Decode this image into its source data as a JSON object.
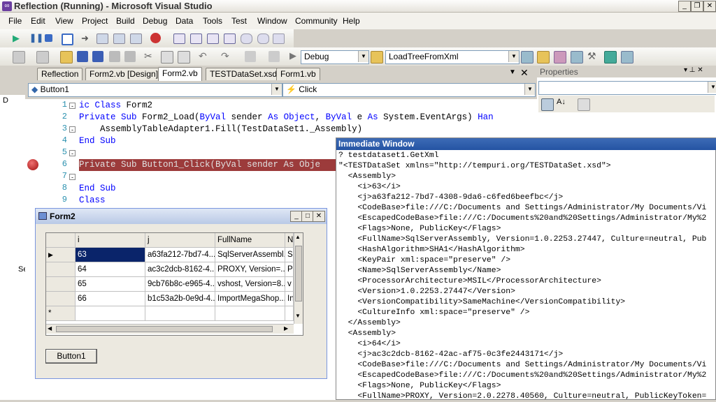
{
  "window": {
    "title": "Reflection (Running) - Microsoft Visual Studio"
  },
  "menu": [
    "File",
    "Edit",
    "View",
    "Project",
    "Build",
    "Debug",
    "Data",
    "Tools",
    "Test",
    "Window",
    "Community",
    "Help"
  ],
  "toolbar": {
    "config": "Debug",
    "find_combo": "LoadTreeFromXml"
  },
  "tabs": [
    "Reflection",
    "Form2.vb [Design]",
    "Form2.vb",
    "TESTDataSet.xsd",
    "Form1.vb"
  ],
  "active_tab": "Form2.vb",
  "editor": {
    "object_combo": "Button1",
    "event_combo": "Click",
    "lines": [
      {
        "num": "1",
        "parts": [
          {
            "t": "ic Class ",
            "k": true
          },
          {
            "t": "Form2",
            "k": false
          }
        ]
      },
      {
        "num": "2",
        "parts": [
          {
            "t": "Private Sub ",
            "k": true
          },
          {
            "t": "Form2_Load(",
            "k": false
          },
          {
            "t": "ByVal ",
            "k": true
          },
          {
            "t": "sender ",
            "k": false
          },
          {
            "t": "As Object",
            "k": true
          },
          {
            "t": ", ",
            "k": false
          },
          {
            "t": "ByVal ",
            "k": true
          },
          {
            "t": "e ",
            "k": false
          },
          {
            "t": "As ",
            "k": true
          },
          {
            "t": "System.EventArgs) ",
            "k": false
          },
          {
            "t": "Han",
            "k": true
          }
        ]
      },
      {
        "num": "3",
        "parts": [
          {
            "t": "    AssemblyTableAdapter1.Fill(TestDataSet1._Assembly)",
            "k": false
          }
        ]
      },
      {
        "num": "4",
        "parts": [
          {
            "t": "End Sub",
            "k": true
          }
        ]
      },
      {
        "num": "5",
        "parts": []
      },
      {
        "num": "6",
        "parts": [
          {
            "t": "Private Sub Button1_Click(ByVal sender As Obje",
            "k": false
          }
        ]
      },
      {
        "num": "7",
        "parts": []
      },
      {
        "num": "8",
        "parts": [
          {
            "t": "End Sub",
            "k": true
          }
        ]
      },
      {
        "num": "9",
        "parts": [
          {
            "t": "Class",
            "k": true
          }
        ]
      }
    ]
  },
  "properties": {
    "title": "Properties"
  },
  "immediate": {
    "title": "Immediate Window",
    "lines": [
      "? testdataset1.GetXml",
      "\"<TESTDataSet xmlns=\"http://tempuri.org/TESTDataSet.xsd\">",
      "  <Assembly>",
      "    <i>63</i>",
      "    <j>a63fa212-7bd7-4308-9da6-c6fed6beefbc</j>",
      "    <CodeBase>file:///C:/Documents and Settings/Administrator/My Documents/Vi",
      "    <EscapedCodeBase>file:///C:/Documents%20and%20Settings/Administrator/My%2",
      "    <Flags>None, PublicKey</Flags>",
      "    <FullName>SqlServerAssembly, Version=1.0.2253.27447, Culture=neutral, Pub",
      "    <HashAlgorithm>SHA1</HashAlgorithm>",
      "    <KeyPair xml:space=\"preserve\" />",
      "    <Name>SqlServerAssembly</Name>",
      "    <ProcessorArchitecture>MSIL</ProcessorArchitecture>",
      "    <Version>1.0.2253.27447</Version>",
      "    <VersionCompatibility>SameMachine</VersionCompatibility>",
      "    <CultureInfo xml:space=\"preserve\" />",
      "  </Assembly>",
      "  <Assembly>",
      "    <i>64</i>",
      "    <j>ac3c2dcb-8162-42ac-af75-0c3fe2443171</j>",
      "    <CodeBase>file:///C:/Documents and Settings/Administrator/My Documents/Vi",
      "    <EscapedCodeBase>file:///C:/Documents%20and%20Settings/Administrator/My%2",
      "    <Flags>None, PublicKey</Flags>",
      "    <FullName>PROXY, Version=2.0.2278.40560, Culture=neutral, PublicKeyToken="
    ]
  },
  "form2": {
    "title": "Form2",
    "columns": [
      "i",
      "j",
      "FullName",
      "N"
    ],
    "rows": [
      [
        "63",
        "a63fa212-7bd7-4...",
        "SqlServerAssembl...",
        "S"
      ],
      [
        "64",
        "ac3c2dcb-8162-4...",
        "PROXY, Version=...",
        "P"
      ],
      [
        "65",
        "9cb76b8c-e965-4...",
        "vshost, Version=8...",
        "v"
      ],
      [
        "66",
        "b1c53a2b-0e9d-4...",
        "ImportMegaShop...",
        "In"
      ]
    ],
    "new_row_marker": "*",
    "button": "Button1"
  },
  "left_strip": {
    "labels": [
      "D",
      "Se"
    ]
  }
}
